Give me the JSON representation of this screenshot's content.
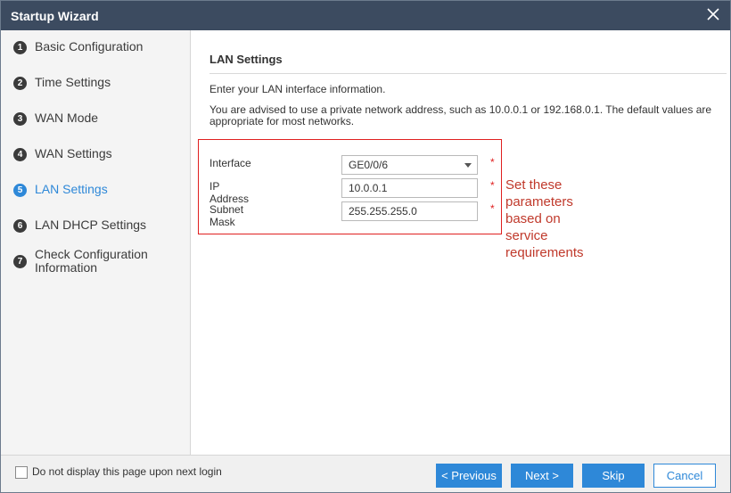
{
  "window": {
    "title": "Startup Wizard",
    "close_icon": "close-icon"
  },
  "sidebar": {
    "steps": [
      {
        "num": "1",
        "label": "Basic Configuration"
      },
      {
        "num": "2",
        "label": "Time Settings"
      },
      {
        "num": "3",
        "label": "WAN Mode"
      },
      {
        "num": "4",
        "label": "WAN Settings"
      },
      {
        "num": "5",
        "label": "LAN Settings"
      },
      {
        "num": "6",
        "label": "LAN DHCP Settings"
      },
      {
        "num": "7",
        "label": "Check Configuration Information"
      }
    ],
    "active_index": 4
  },
  "main": {
    "section_title": "LAN Settings",
    "intro": "Enter your LAN interface information.",
    "advice": "You are advised to use a private network address, such as 10.0.0.1 or 192.168.0.1. The default values are appropriate for most networks.",
    "form": {
      "interface": {
        "label": "Interface",
        "value": "GE0/0/6",
        "required_mark": "*"
      },
      "ip_address": {
        "label": "IP Address",
        "value": "10.0.0.1",
        "required_mark": "*"
      },
      "subnet_mask": {
        "label": "Subnet Mask",
        "value": "255.255.255.0",
        "required_mark": "*"
      }
    },
    "callout": "Set these parameters based on service requirements"
  },
  "footer": {
    "checkbox_label": "Do not display this page upon next login",
    "checkbox_checked": false,
    "buttons": {
      "previous": "< Previous",
      "next": "Next >",
      "skip": "Skip",
      "cancel": "Cancel"
    }
  },
  "colors": {
    "titlebar": "#3c4b60",
    "accent": "#2e88d8",
    "highlight_border": "#e02020",
    "callout_text": "#c0392b"
  }
}
